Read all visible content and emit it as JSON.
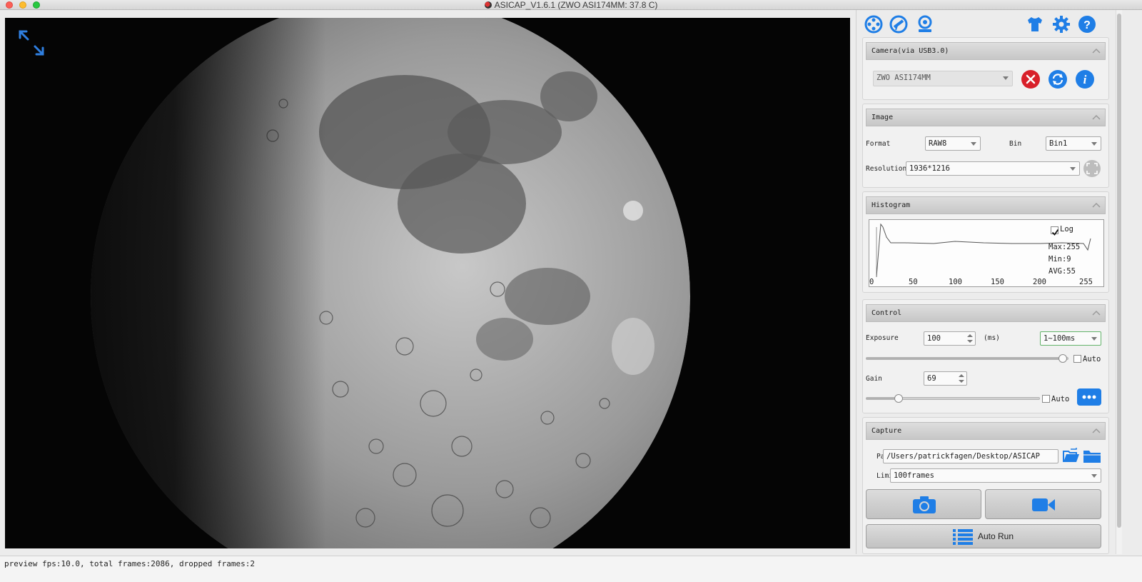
{
  "window": {
    "title": "ASICAP_V1.6.1 (ZWO ASI174MM: 37.8 C)"
  },
  "status": {
    "text": "preview fps:10.0, total frames:2086, dropped frames:2"
  },
  "toolbar": {
    "icons": [
      "film-reel-icon",
      "telescope-icon",
      "camera-mount-icon",
      "tshirt-theme-icon",
      "gear-icon",
      "help-icon"
    ]
  },
  "camera": {
    "title": "Camera(via USB3.0)",
    "selected": "ZWO ASI174MM"
  },
  "image": {
    "title": "Image",
    "format_label": "Format",
    "format_value": "RAW8",
    "bin_label": "Bin",
    "bin_value": "Bin1",
    "resolution_label": "Resolution",
    "resolution_value": "1936*1216"
  },
  "histogram": {
    "title": "Histogram",
    "log_label": "Log",
    "log_checked": true,
    "max": "Max:255",
    "min": "Min:9",
    "avg": "AVG:55",
    "x_ticks": [
      "0",
      "50",
      "100",
      "150",
      "200",
      "255"
    ]
  },
  "control": {
    "title": "Control",
    "exposure_label": "Exposure",
    "exposure_value": "100",
    "exposure_unit": "(ms)",
    "exposure_range": "1~100ms",
    "exposure_level": 0.99,
    "exposure_auto_label": "Auto",
    "gain_label": "Gain",
    "gain_value": "69",
    "gain_level": 0.17,
    "gain_auto_label": "Auto"
  },
  "capture": {
    "title": "Capture",
    "path_label": "Path",
    "path_value": "/Users/patrickfagen/Desktop/ASICAP",
    "limit_label": "Limit",
    "limit_value": "100frames",
    "auto_run_label": "Auto Run"
  },
  "colors": {
    "accent": "#1f7ee6",
    "danger": "#d8202a"
  }
}
